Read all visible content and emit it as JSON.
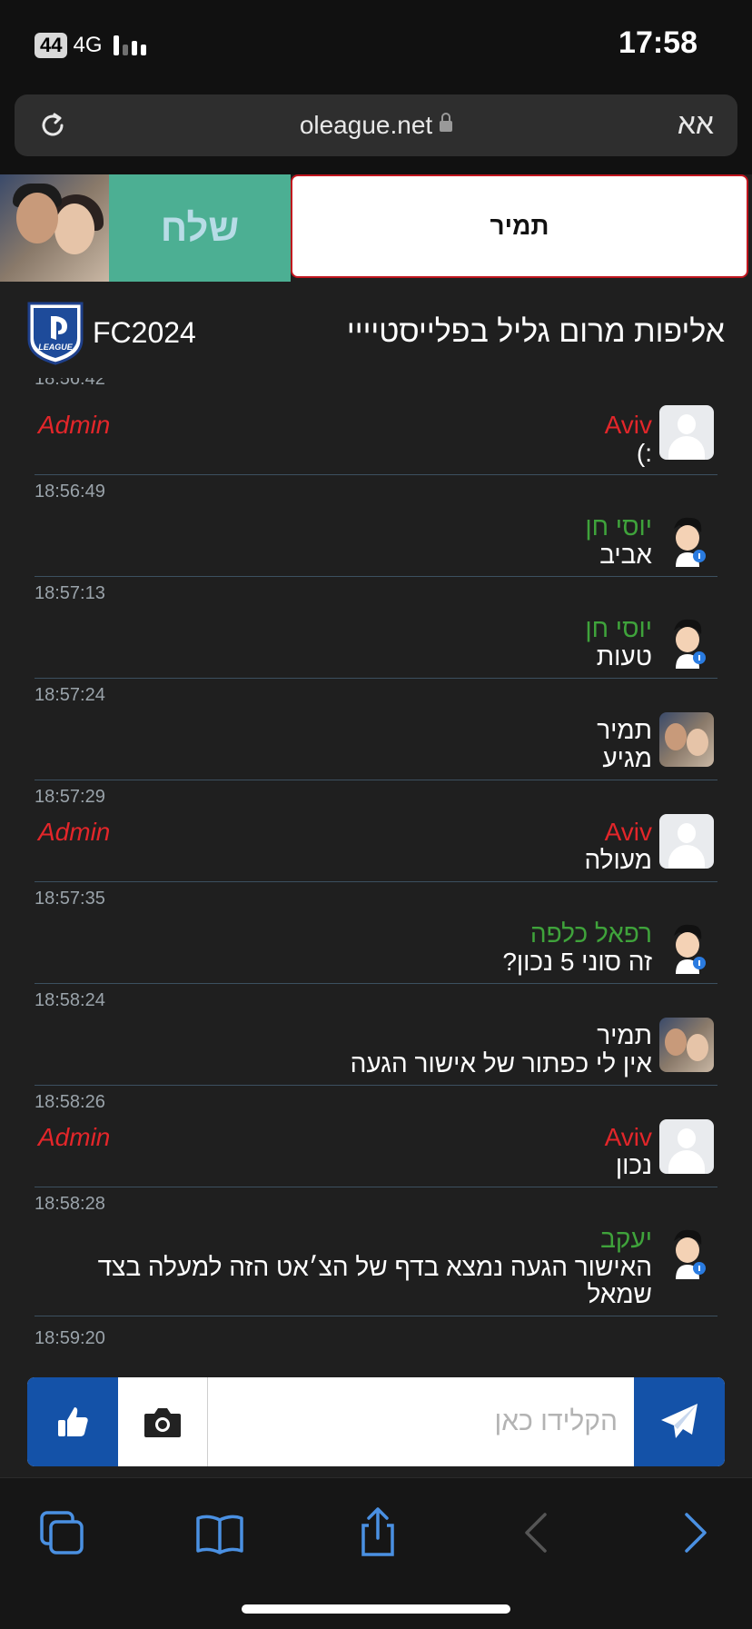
{
  "status_bar": {
    "battery": "44",
    "network": "4G",
    "time": "17:58"
  },
  "browser": {
    "url": "oleague.net",
    "text_size_label": "אא"
  },
  "user_bar": {
    "send_label": "שלח",
    "username": "תמיר"
  },
  "header": {
    "league_code": "FC2024",
    "title": "אליפות מרום גליל בפלייסטיייי",
    "logo_text": "LEAGUE"
  },
  "chat": {
    "cut_timestamp": "18:56:42",
    "messages": [
      {
        "timestamp": "",
        "name": "Aviv",
        "text": ":)",
        "admin": "Admin"
      },
      {
        "timestamp": "18:56:49",
        "name": "יוסי חן",
        "text": "אביב",
        "admin": ""
      },
      {
        "timestamp": "18:57:13",
        "name": "יוסי חן",
        "text": "טעות",
        "admin": ""
      },
      {
        "timestamp": "18:57:24",
        "name": "תמיר",
        "text": "מגיע",
        "admin": ""
      },
      {
        "timestamp": "18:57:29",
        "name": "Aviv",
        "text": "מעולה",
        "admin": "Admin"
      },
      {
        "timestamp": "18:57:35",
        "name": "רפאל כלפה",
        "text": "זה סוני 5 נכון?",
        "admin": ""
      },
      {
        "timestamp": "18:58:24",
        "name": "תמיר",
        "text": "אין לי כפתור של אישור הגעה",
        "admin": ""
      },
      {
        "timestamp": "18:58:26",
        "name": "Aviv",
        "text": "נכון",
        "admin": "Admin"
      },
      {
        "timestamp": "18:58:28",
        "name": "יעקב",
        "text": "האישור הגעה נמצא בדף של הצ׳אט הזה למעלה בצד שמאל",
        "admin": ""
      }
    ],
    "last_timestamp": "18:59:20"
  },
  "composer": {
    "placeholder": "הקלידו כאן"
  },
  "colors": {
    "admin": "#e3262a",
    "user_green": "#3fa33b",
    "accent_blue": "#1452a8",
    "send_green": "#4caf93"
  },
  "icons": [
    "reload-icon",
    "lock-icon",
    "like-icon",
    "camera-icon",
    "send-icon",
    "tabs-icon",
    "bookmarks-icon",
    "share-icon",
    "back-icon",
    "forward-icon"
  ]
}
